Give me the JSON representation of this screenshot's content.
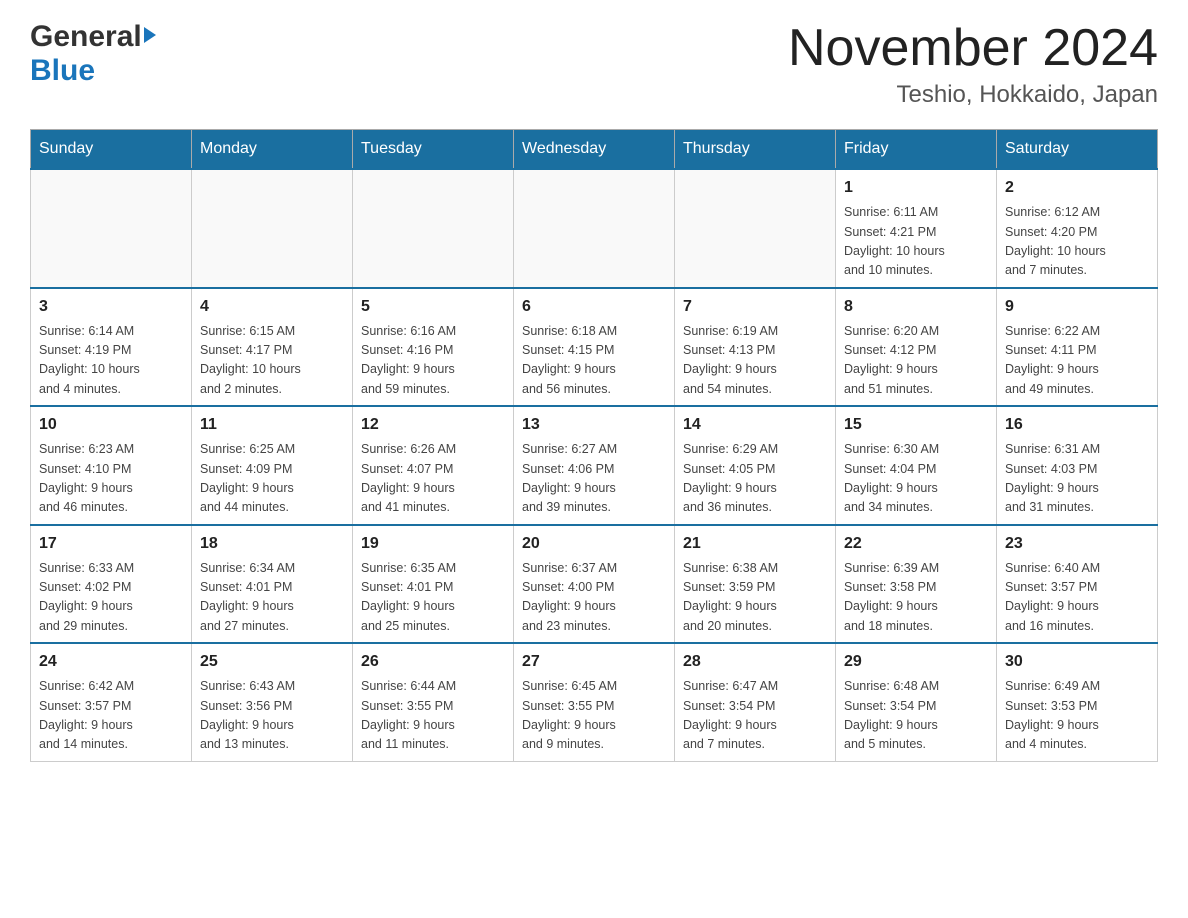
{
  "header": {
    "logo_general": "General",
    "logo_blue": "Blue",
    "month_title": "November 2024",
    "location": "Teshio, Hokkaido, Japan"
  },
  "weekdays": [
    "Sunday",
    "Monday",
    "Tuesday",
    "Wednesday",
    "Thursday",
    "Friday",
    "Saturday"
  ],
  "weeks": [
    [
      {
        "day": "",
        "info": ""
      },
      {
        "day": "",
        "info": ""
      },
      {
        "day": "",
        "info": ""
      },
      {
        "day": "",
        "info": ""
      },
      {
        "day": "",
        "info": ""
      },
      {
        "day": "1",
        "info": "Sunrise: 6:11 AM\nSunset: 4:21 PM\nDaylight: 10 hours\nand 10 minutes."
      },
      {
        "day": "2",
        "info": "Sunrise: 6:12 AM\nSunset: 4:20 PM\nDaylight: 10 hours\nand 7 minutes."
      }
    ],
    [
      {
        "day": "3",
        "info": "Sunrise: 6:14 AM\nSunset: 4:19 PM\nDaylight: 10 hours\nand 4 minutes."
      },
      {
        "day": "4",
        "info": "Sunrise: 6:15 AM\nSunset: 4:17 PM\nDaylight: 10 hours\nand 2 minutes."
      },
      {
        "day": "5",
        "info": "Sunrise: 6:16 AM\nSunset: 4:16 PM\nDaylight: 9 hours\nand 59 minutes."
      },
      {
        "day": "6",
        "info": "Sunrise: 6:18 AM\nSunset: 4:15 PM\nDaylight: 9 hours\nand 56 minutes."
      },
      {
        "day": "7",
        "info": "Sunrise: 6:19 AM\nSunset: 4:13 PM\nDaylight: 9 hours\nand 54 minutes."
      },
      {
        "day": "8",
        "info": "Sunrise: 6:20 AM\nSunset: 4:12 PM\nDaylight: 9 hours\nand 51 minutes."
      },
      {
        "day": "9",
        "info": "Sunrise: 6:22 AM\nSunset: 4:11 PM\nDaylight: 9 hours\nand 49 minutes."
      }
    ],
    [
      {
        "day": "10",
        "info": "Sunrise: 6:23 AM\nSunset: 4:10 PM\nDaylight: 9 hours\nand 46 minutes."
      },
      {
        "day": "11",
        "info": "Sunrise: 6:25 AM\nSunset: 4:09 PM\nDaylight: 9 hours\nand 44 minutes."
      },
      {
        "day": "12",
        "info": "Sunrise: 6:26 AM\nSunset: 4:07 PM\nDaylight: 9 hours\nand 41 minutes."
      },
      {
        "day": "13",
        "info": "Sunrise: 6:27 AM\nSunset: 4:06 PM\nDaylight: 9 hours\nand 39 minutes."
      },
      {
        "day": "14",
        "info": "Sunrise: 6:29 AM\nSunset: 4:05 PM\nDaylight: 9 hours\nand 36 minutes."
      },
      {
        "day": "15",
        "info": "Sunrise: 6:30 AM\nSunset: 4:04 PM\nDaylight: 9 hours\nand 34 minutes."
      },
      {
        "day": "16",
        "info": "Sunrise: 6:31 AM\nSunset: 4:03 PM\nDaylight: 9 hours\nand 31 minutes."
      }
    ],
    [
      {
        "day": "17",
        "info": "Sunrise: 6:33 AM\nSunset: 4:02 PM\nDaylight: 9 hours\nand 29 minutes."
      },
      {
        "day": "18",
        "info": "Sunrise: 6:34 AM\nSunset: 4:01 PM\nDaylight: 9 hours\nand 27 minutes."
      },
      {
        "day": "19",
        "info": "Sunrise: 6:35 AM\nSunset: 4:01 PM\nDaylight: 9 hours\nand 25 minutes."
      },
      {
        "day": "20",
        "info": "Sunrise: 6:37 AM\nSunset: 4:00 PM\nDaylight: 9 hours\nand 23 minutes."
      },
      {
        "day": "21",
        "info": "Sunrise: 6:38 AM\nSunset: 3:59 PM\nDaylight: 9 hours\nand 20 minutes."
      },
      {
        "day": "22",
        "info": "Sunrise: 6:39 AM\nSunset: 3:58 PM\nDaylight: 9 hours\nand 18 minutes."
      },
      {
        "day": "23",
        "info": "Sunrise: 6:40 AM\nSunset: 3:57 PM\nDaylight: 9 hours\nand 16 minutes."
      }
    ],
    [
      {
        "day": "24",
        "info": "Sunrise: 6:42 AM\nSunset: 3:57 PM\nDaylight: 9 hours\nand 14 minutes."
      },
      {
        "day": "25",
        "info": "Sunrise: 6:43 AM\nSunset: 3:56 PM\nDaylight: 9 hours\nand 13 minutes."
      },
      {
        "day": "26",
        "info": "Sunrise: 6:44 AM\nSunset: 3:55 PM\nDaylight: 9 hours\nand 11 minutes."
      },
      {
        "day": "27",
        "info": "Sunrise: 6:45 AM\nSunset: 3:55 PM\nDaylight: 9 hours\nand 9 minutes."
      },
      {
        "day": "28",
        "info": "Sunrise: 6:47 AM\nSunset: 3:54 PM\nDaylight: 9 hours\nand 7 minutes."
      },
      {
        "day": "29",
        "info": "Sunrise: 6:48 AM\nSunset: 3:54 PM\nDaylight: 9 hours\nand 5 minutes."
      },
      {
        "day": "30",
        "info": "Sunrise: 6:49 AM\nSunset: 3:53 PM\nDaylight: 9 hours\nand 4 minutes."
      }
    ]
  ]
}
